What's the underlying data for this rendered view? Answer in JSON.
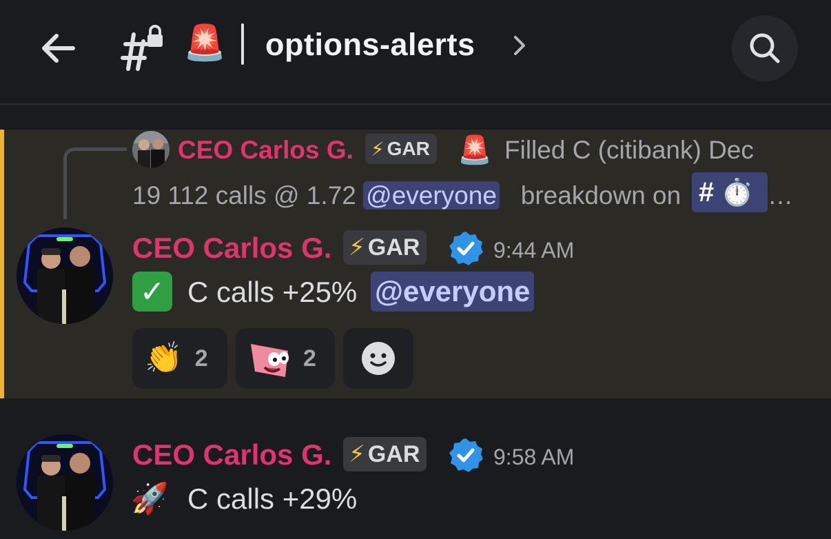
{
  "header": {
    "back_icon": "arrow-left-icon",
    "channel_icon": "locked-hashtag-icon",
    "channel_emoji": "🚨",
    "channel_name": "options-alerts",
    "chevron_icon": "chevron-right-icon",
    "search_icon": "search-icon"
  },
  "reply_preview": {
    "author": "CEO Carlos G.",
    "tag": "GAR",
    "tag_icon": "⚡",
    "emoji": "🚨",
    "text_line1": "Filled C (citibank) Dec",
    "text_line2_prefix": "19 112 calls @ 1.72 ",
    "mention": "@everyone",
    "text_line2_middle": "breakdown on",
    "channel_mention_hash": "#",
    "channel_mention_emoji": "⏱️",
    "ellipsis": "…"
  },
  "messages": [
    {
      "author": "CEO Carlos G.",
      "tag": "GAR",
      "tag_icon": "⚡",
      "verified_icon": "verified-badge-icon",
      "time": "9:44 AM",
      "emoji": "✓",
      "text": "C calls +25%",
      "mention": "@everyone",
      "reactions": [
        {
          "emoji": "👏",
          "count": "2"
        },
        {
          "emoji": "patrick-star-sticker",
          "count": "2"
        }
      ],
      "add_reaction_icon": "add-reaction-smiley-icon"
    },
    {
      "author": "CEO Carlos G.",
      "tag": "GAR",
      "tag_icon": "⚡",
      "verified_icon": "verified-badge-icon",
      "time": "9:58 AM",
      "emoji": "🚀",
      "text": "C calls +29%"
    }
  ],
  "colors": {
    "background": "#1a1b1f",
    "highlight": "#2c2a24",
    "highlight_bar": "#f0b232",
    "author": "#e0346c",
    "mention_bg": "#3e4376",
    "verified": "#2f93e8"
  }
}
